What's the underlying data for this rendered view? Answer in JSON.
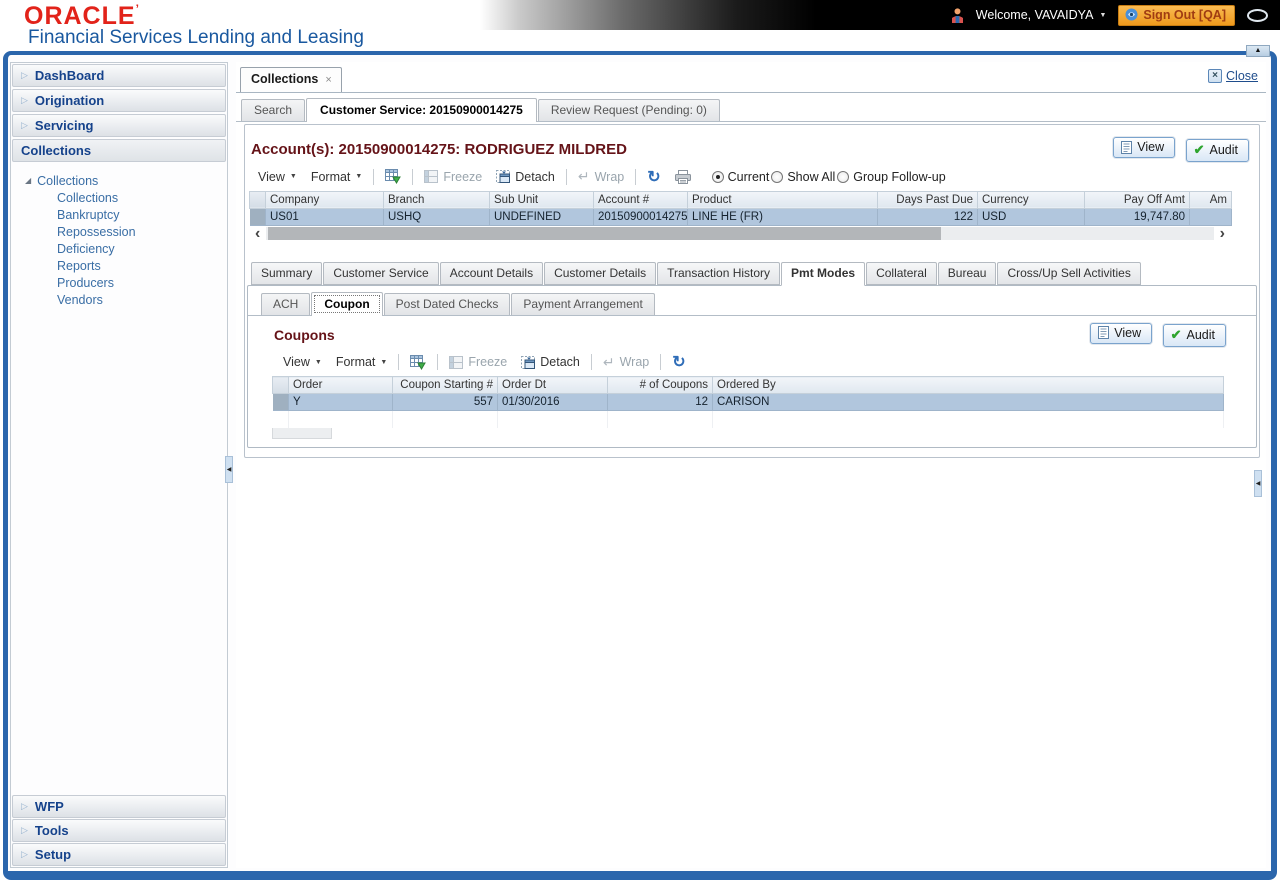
{
  "header": {
    "logo": "ORACLE",
    "logo_mark": "’",
    "subtitle": "Financial Services Lending and Leasing",
    "welcome": "Welcome, VAVAIDYA",
    "sign_out": "Sign Out [QA]"
  },
  "glyphs": {
    "chevron": "▷",
    "tree_open": "◢",
    "caret_down": "▼",
    "scroll_left": "‹",
    "scroll_right": "›",
    "collapse_left": "◀",
    "scroll_up": "▲",
    "wrap": "↵",
    "refresh": "↻",
    "close_x": "×",
    "tab_close_x": "×",
    "check": "✔"
  },
  "sidebar": {
    "items": [
      {
        "label": "DashBoard"
      },
      {
        "label": "Origination"
      },
      {
        "label": "Servicing"
      },
      {
        "label": "Collections"
      }
    ],
    "tree_root": "Collections",
    "tree_children": [
      "Collections",
      "Bankruptcy",
      "Repossession",
      "Deficiency",
      "Reports",
      "Producers",
      "Vendors"
    ],
    "bottom_items": [
      {
        "label": "WFP"
      },
      {
        "label": "Tools"
      },
      {
        "label": "Setup"
      }
    ]
  },
  "workspace": {
    "main_tab": "Collections",
    "close_label": "Close",
    "subtabs": [
      "Search",
      "Customer Service: 20150900014275",
      "Review Request (Pending: 0)"
    ]
  },
  "account_section": {
    "title": "Account(s): 20150900014275: RODRIGUEZ MILDRED",
    "view_button": "View",
    "audit_button": "Audit",
    "toolbar": {
      "view": "View",
      "format": "Format",
      "freeze": "Freeze",
      "detach": "Detach",
      "wrap": "Wrap"
    },
    "filters": [
      {
        "label": "Current",
        "selected": true
      },
      {
        "label": "Show All",
        "selected": false
      },
      {
        "label": "Group Follow-up",
        "selected": false
      }
    ],
    "table": {
      "columns": [
        "Company",
        "Branch",
        "Sub Unit",
        "Account #",
        "Product",
        "Days Past Due",
        "Currency",
        "Pay Off Amt",
        "Am"
      ],
      "row": {
        "company": "US01",
        "branch": "USHQ",
        "sub_unit": "UNDEFINED",
        "account": "20150900014275",
        "product": "LINE HE (FR)",
        "days_past_due": "122",
        "currency": "USD",
        "pay_off_amt": "19,747.80"
      }
    }
  },
  "detail_tabs": [
    "Summary",
    "Customer Service",
    "Account Details",
    "Customer Details",
    "Transaction History",
    "Pmt Modes",
    "Collateral",
    "Bureau",
    "Cross/Up Sell Activities"
  ],
  "pmt_modes": {
    "subtabs": [
      "ACH",
      "Coupon",
      "Post Dated Checks",
      "Payment Arrangement"
    ],
    "coupons": {
      "title": "Coupons",
      "view_button": "View",
      "audit_button": "Audit",
      "toolbar": {
        "view": "View",
        "format": "Format",
        "freeze": "Freeze",
        "detach": "Detach",
        "wrap": "Wrap"
      },
      "columns": [
        "Order",
        "Coupon Starting #",
        "Order Dt",
        "# of Coupons",
        "Ordered By"
      ],
      "row": {
        "order": "Y",
        "coupon_starting": "557",
        "order_dt": "01/30/2016",
        "num_coupons": "12",
        "ordered_by": "CARISON"
      }
    }
  }
}
